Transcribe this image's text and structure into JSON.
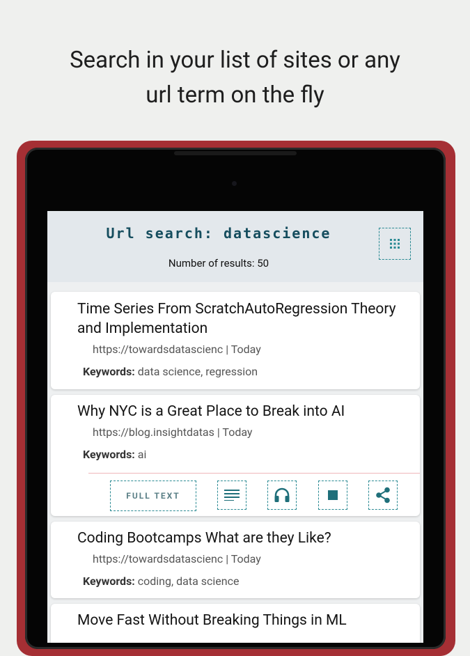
{
  "headline": {
    "line1": "Search in your list of sites or any",
    "line2": "url term on the fly"
  },
  "header": {
    "title": "Url search: datascience",
    "results_count": "Number of results: 50",
    "grid_icon": "grid-icon"
  },
  "results": [
    {
      "title": "Time Series From ScratchAutoRegression Theory and Implementation",
      "url": "https://towardsdatascienc | Today",
      "keywords_label": "Keywords:",
      "keywords": " data science, regression"
    },
    {
      "title": "Why NYC is a Great Place to Break into AI",
      "url": "https://blog.insightdatas | Today",
      "keywords_label": "Keywords:",
      "keywords": " ai"
    },
    {
      "title": "Coding Bootcamps What are they Like?",
      "url": "https://towardsdatascienc | Today",
      "keywords_label": "Keywords:",
      "keywords": " coding, data science"
    },
    {
      "title": "Move Fast Without Breaking Things in ML"
    }
  ],
  "actions": {
    "full_text": "FULL TEXT",
    "icons": [
      "notes-icon",
      "headphones-icon",
      "stop-icon",
      "share-icon"
    ]
  },
  "colors": {
    "accent": "#2a8a93",
    "title_color": "#154d5e",
    "device_red": "#a52f34",
    "divider": "#f0b7ba"
  }
}
